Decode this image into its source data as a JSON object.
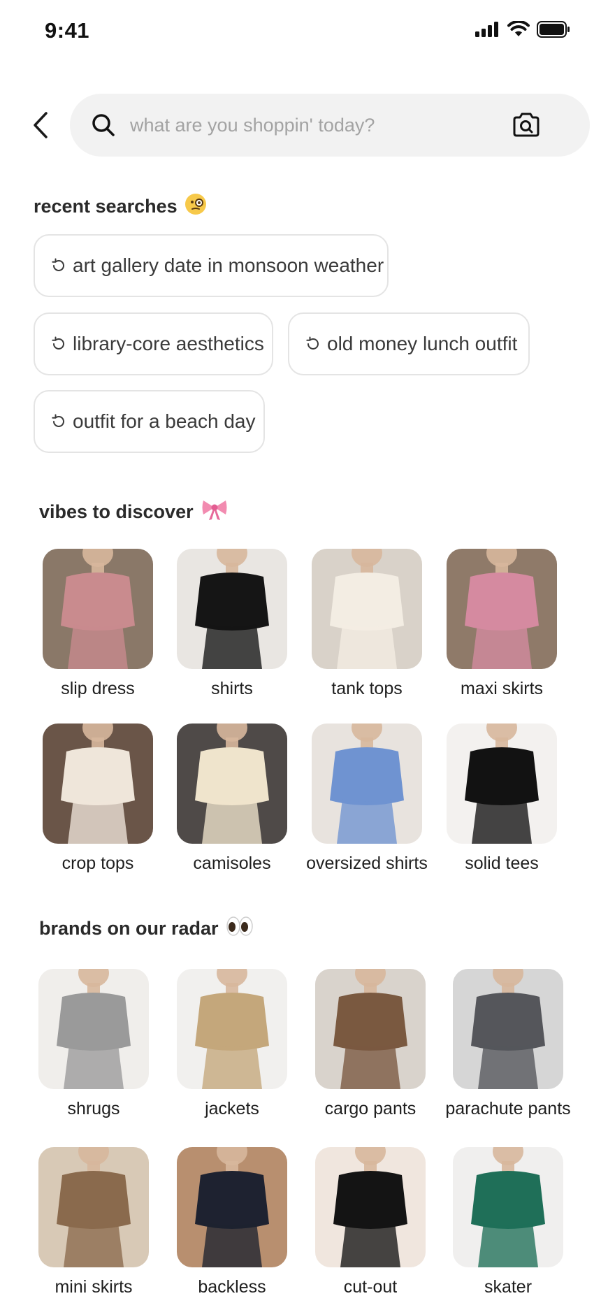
{
  "status_bar": {
    "time": "9:41"
  },
  "search": {
    "placeholder": "what are you shoppin' today?"
  },
  "recent": {
    "title": "recent searches",
    "items": [
      "art gallery date in monsoon weather",
      "library-core aesthetics",
      "old money lunch outfit",
      "outfit for a beach day"
    ]
  },
  "vibes": {
    "title": "vibes to discover",
    "items": [
      {
        "label": "slip dress",
        "bg": "#8a7868",
        "fg": "#c98b8e"
      },
      {
        "label": "shirts",
        "bg": "#e9e6e2",
        "fg": "#151515"
      },
      {
        "label": "tank tops",
        "bg": "#d9d2c9",
        "fg": "#f3ede3"
      },
      {
        "label": "maxi skirts",
        "bg": "#8f7a69",
        "fg": "#d58aa0"
      },
      {
        "label": "crop tops",
        "bg": "#6a5548",
        "fg": "#efe6da"
      },
      {
        "label": "camisoles",
        "bg": "#4f4a48",
        "fg": "#efe4cc"
      },
      {
        "label": "oversized shirts",
        "bg": "#e8e3de",
        "fg": "#6f93d1"
      },
      {
        "label": "solid tees",
        "bg": "#f3f1ef",
        "fg": "#121212"
      }
    ]
  },
  "brands": {
    "title": "brands on our radar",
    "items": [
      {
        "label": "shrugs",
        "bg": "#f0eeeb",
        "fg": "#9a9a9a"
      },
      {
        "label": "jackets",
        "bg": "#f1f0ee",
        "fg": "#c4a77b"
      },
      {
        "label": "cargo pants",
        "bg": "#d9d3cc",
        "fg": "#7a5940"
      },
      {
        "label": "parachute pants",
        "bg": "#d6d6d6",
        "fg": "#55565b"
      },
      {
        "label": "mini skirts",
        "bg": "#d8c9b6",
        "fg": "#8a6a4d"
      },
      {
        "label": "backless",
        "bg": "#b88f6f",
        "fg": "#1e2230"
      },
      {
        "label": "cut-out",
        "bg": "#f0e6de",
        "fg": "#141414"
      },
      {
        "label": "skater",
        "bg": "#f0efee",
        "fg": "#1f6f58"
      }
    ]
  }
}
